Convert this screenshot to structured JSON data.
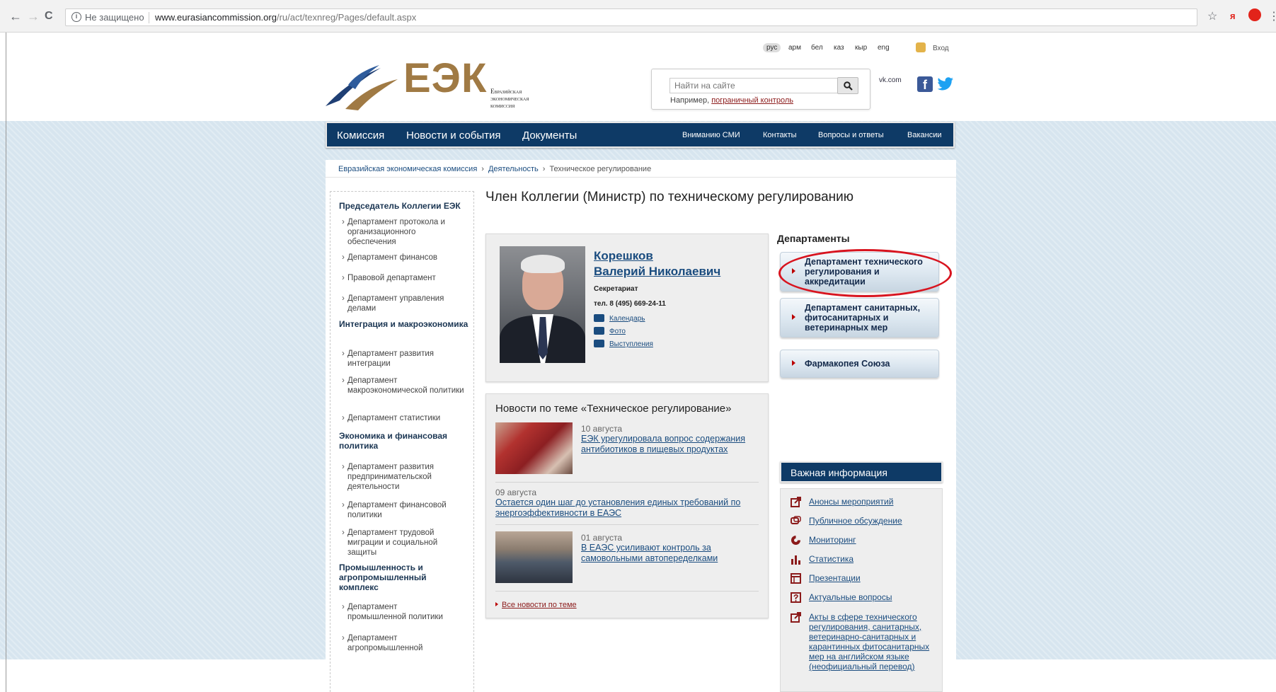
{
  "browser": {
    "back": "←",
    "forward": "→",
    "reload": "C",
    "security": "Не защищено",
    "url_host": "www.eurasiancommission.org",
    "url_path": "/ru/act/texnreg/Pages/default.aspx",
    "bookmark": "☆",
    "yandex": "я",
    "menu": "⋮"
  },
  "langs": [
    "рус",
    "арм",
    "бел",
    "каз",
    "кыр",
    "eng"
  ],
  "login": "Вход",
  "logo": {
    "abbr": "ЕЭК",
    "line1": "Евразийская",
    "line2": "экономическая",
    "line3": "комиссия"
  },
  "search": {
    "placeholder": "Найти на сайте",
    "hint_prefix": "Например,",
    "hint_link": "пограничный контроль"
  },
  "social": {
    "vk_alt": "vk.com",
    "fb": "f"
  },
  "nav": {
    "main": [
      "Комиссия",
      "Новости и события",
      "Документы"
    ],
    "secondary": [
      "Вниманию СМИ",
      "Контакты",
      "Вопросы и ответы",
      "Вакансии"
    ]
  },
  "breadcrumb": [
    "Евразийская экономическая комиссия",
    "Деятельность",
    "Техническое регулирование"
  ],
  "sidebar": {
    "h1": "Председатель Коллегии ЕЭК",
    "g1": [
      "Департамент протокола и организационного обеспечения",
      "Департамент финансов",
      "Правовой департамент",
      "Департамент управления делами"
    ],
    "h2": "Интеграция и макроэкономика",
    "g2": [
      "Департамент развития интеграции",
      "Департамент макроэкономической политики",
      "Департамент статистики"
    ],
    "h3": "Экономика и финансовая политика",
    "g3": [
      "Департамент развития предпринимательской деятельности",
      "Департамент финансовой политики",
      "Департамент трудовой миграции и социальной защиты"
    ],
    "h4": "Промышленность и агропромышленный комплекс",
    "g4": [
      "Департамент промышленной политики",
      "Департамент агропромышленной"
    ]
  },
  "page_title": "Член Коллегии (Министр) по техническому регулированию",
  "person": {
    "name_line1": "Корешков",
    "name_line2": "Валерий Николаевич",
    "dept": "Секретариат",
    "tel": "тел. 8 (495) 669-24-11",
    "links": [
      "Календарь",
      "Фото",
      "Выступления"
    ]
  },
  "news": {
    "title": "Новости по теме «Техническое регулирование»",
    "items": [
      {
        "date": "10 августа",
        "text_l1": "ЕЭК урегулировала вопрос содержания",
        "text_l2": "антибиотиков в пищевых продуктах"
      },
      {
        "date": "09 августа",
        "text_l1": "Остается один шаг до установления единых требований по",
        "text_l2": "энергоэффективности в ЕАЭС"
      },
      {
        "date": "01 августа",
        "text_l1": "В ЕАЭС усиливают контроль за",
        "text_l2": "самовольными автопеределками"
      }
    ],
    "all": "Все новости по теме"
  },
  "departments": {
    "title": "Департаменты",
    "items": [
      "Департамент технического регулирования и аккредитации",
      "Департамент санитарных, фитосанитарных и ветеринарных мер",
      "Фармакопея Союза"
    ]
  },
  "important": {
    "title": "Важная информация",
    "items": [
      "Анонсы мероприятий",
      "Публичное обсуждение",
      "Мониторинг",
      "Статистика",
      "Презентации",
      "Актуальные вопросы",
      "Акты в сфере технического регулирования, санитарных, ветеринарно-санитарных и карантинных фитосанитарных мер на английском языке (неофициальный перевод)"
    ]
  },
  "colors": {
    "nav_bg": "#0e3a66",
    "link": "#1a4c7f",
    "accent_red": "#d8141f",
    "logo_gold": "#a07a44"
  }
}
